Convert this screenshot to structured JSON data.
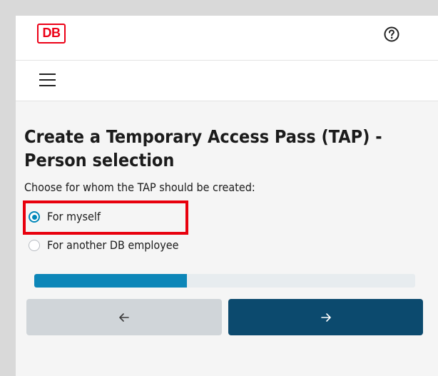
{
  "header": {
    "logo_text": "DB",
    "help_icon": "help-circle-icon"
  },
  "nav": {
    "menu_icon": "hamburger-menu-icon"
  },
  "page": {
    "title": "Create a Temporary Access Pass (TAP) - Person selection",
    "prompt": "Choose for whom the TAP should be created:"
  },
  "options": [
    {
      "label": "For myself",
      "checked": true
    },
    {
      "label": "For another DB employee",
      "checked": false
    }
  ],
  "progress": {
    "fraction": 0.4
  },
  "buttons": {
    "back_icon": "arrow-left-icon",
    "next_icon": "arrow-right-icon"
  },
  "colors": {
    "brand_red": "#ec0016",
    "accent": "#0087b9",
    "primary_button": "#0c4a6e",
    "secondary_button": "#d0d5d9",
    "highlight": "#e8000d"
  }
}
